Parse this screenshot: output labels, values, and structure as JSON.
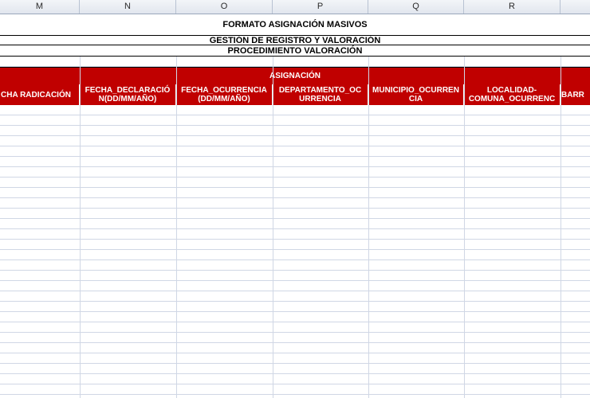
{
  "columns": [
    "M",
    "N",
    "O",
    "P",
    "Q",
    "R"
  ],
  "titles": {
    "main": "FORMATO ASIGNACIÓN MASIVOS",
    "sub1": "GESTIÓN DE REGISTRO Y VALORACIÓN",
    "sub2": "PROCEDIMIENTO VALORACIÓN"
  },
  "group_header": "ASIGNACIÓN",
  "headers": [
    "CHA RADICACIÓN",
    "FECHA_DECLARACIÓ N(DD/MM/AÑO)",
    "FECHA_OCURRENCIA (DD/MM/AÑO)",
    "DEPARTAMENTO_OC URRENCIA",
    "MUNICIPIO_OCURREN CIA",
    "LOCALIDAD- COMUNA_OCURRENC",
    "BARR"
  ],
  "colors": {
    "header_red": "#c00000",
    "header_text": "#ffffff",
    "gridline": "#d0d7e5"
  }
}
